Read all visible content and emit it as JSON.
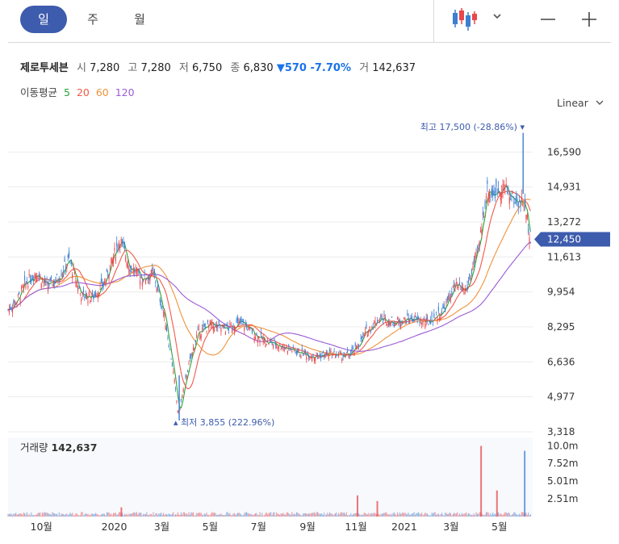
{
  "tabs": [
    {
      "label": "일",
      "active": true
    },
    {
      "label": "주",
      "active": false
    },
    {
      "label": "월",
      "active": false
    }
  ],
  "toolbar": {
    "chart_type_icon": "candlestick-icon",
    "dropdown_icon": "chevron-down-icon",
    "zoom_out_icon": "minus-icon",
    "zoom_in_icon": "plus-icon"
  },
  "header": {
    "name": "제로투세븐",
    "open_label": "시",
    "open": "7,280",
    "high_label": "고",
    "high": "7,280",
    "low_label": "저",
    "low": "6,750",
    "close_label": "종",
    "close": "6,830",
    "change": "▼570 -7.70%",
    "volume_label": "거",
    "volume": "142,637"
  },
  "ma_legend": {
    "label": "이동평균",
    "ma5": "5",
    "ma20": "20",
    "ma60": "60",
    "ma120": "120"
  },
  "scale_mode": "Linear",
  "colors": {
    "up": "#e8474b",
    "down": "#3d7fd1",
    "ma5": "#2aa33c",
    "ma20": "#f05a4a",
    "ma60": "#f0923a",
    "ma120": "#9b5bd6",
    "current_price_bg": "#3e5cad"
  },
  "chart_data": {
    "type": "candlestick",
    "price_axis_ticks": [
      16590,
      14931,
      13272,
      11613,
      9954,
      8295,
      6636,
      4977,
      3318
    ],
    "price_axis_labels": [
      "16,590",
      "14,931",
      "13,272",
      "11,613",
      "9,954",
      "8,295",
      "6,636",
      "4,977",
      "3,318"
    ],
    "ylim": [
      3318,
      18249
    ],
    "current_price": 12450,
    "current_price_label": "12,450",
    "max_label": "최고 17,500 (-28.86%)",
    "min_label": "최저 3,855 (222.96%)",
    "max_value": 17500,
    "min_value": 3855,
    "volume_label": "거래량",
    "volume_value": "142,637",
    "volume_axis_ticks": [
      10000000,
      7520000,
      5010000,
      2510000
    ],
    "volume_axis_labels": [
      "10.0m",
      "7.52m",
      "5.01m",
      "2.51m"
    ],
    "x_tick_labels": [
      "10월",
      "2020",
      "3월",
      "5월",
      "7월",
      "9월",
      "11월",
      "2021",
      "3월",
      "5월"
    ],
    "x_tick_dates": [
      "2019-10-01",
      "2020-01-01",
      "2020-03-01",
      "2020-05-01",
      "2020-07-01",
      "2020-09-01",
      "2020-11-01",
      "2021-01-01",
      "2021-03-01",
      "2021-05-01"
    ],
    "close_path": [
      [
        "2019-08-20",
        9100
      ],
      [
        "2019-09-01",
        9600
      ],
      [
        "2019-09-12",
        10400
      ],
      [
        "2019-09-25",
        10900
      ],
      [
        "2019-10-08",
        10200
      ],
      [
        "2019-10-22",
        10600
      ],
      [
        "2019-11-05",
        11500
      ],
      [
        "2019-11-20",
        9800
      ],
      [
        "2019-12-05",
        9700
      ],
      [
        "2019-12-20",
        10400
      ],
      [
        "2020-01-08",
        12500
      ],
      [
        "2020-01-20",
        11200
      ],
      [
        "2020-02-05",
        10600
      ],
      [
        "2020-02-20",
        10800
      ],
      [
        "2020-03-05",
        8700
      ],
      [
        "2020-03-15",
        6300
      ],
      [
        "2020-03-22",
        4100
      ],
      [
        "2020-04-01",
        6000
      ],
      [
        "2020-04-15",
        8000
      ],
      [
        "2020-05-01",
        8400
      ],
      [
        "2020-05-20",
        8200
      ],
      [
        "2020-06-10",
        8500
      ],
      [
        "2020-06-25",
        8000
      ],
      [
        "2020-07-10",
        7600
      ],
      [
        "2020-07-30",
        7400
      ],
      [
        "2020-08-20",
        7100
      ],
      [
        "2020-09-10",
        6900
      ],
      [
        "2020-09-30",
        7000
      ],
      [
        "2020-10-20",
        6900
      ],
      [
        "2020-10-31",
        7200
      ],
      [
        "2020-11-15",
        8100
      ],
      [
        "2020-12-01",
        8700
      ],
      [
        "2020-12-20",
        8500
      ],
      [
        "2021-01-10",
        8700
      ],
      [
        "2021-01-30",
        8500
      ],
      [
        "2021-02-20",
        9100
      ],
      [
        "2021-03-05",
        10200
      ],
      [
        "2021-03-20",
        10000
      ],
      [
        "2021-04-05",
        12000
      ],
      [
        "2021-04-15",
        14800
      ],
      [
        "2021-04-25",
        14600
      ],
      [
        "2021-05-05",
        15000
      ],
      [
        "2021-05-20",
        14300
      ],
      [
        "2021-06-01",
        14200
      ],
      [
        "2021-06-10",
        12450
      ]
    ],
    "series": [
      {
        "name": "5",
        "color": "#2aa33c"
      },
      {
        "name": "20",
        "color": "#f05a4a"
      },
      {
        "name": "60",
        "color": "#f0923a"
      },
      {
        "name": "120",
        "color": "#9b5bd6"
      }
    ]
  }
}
